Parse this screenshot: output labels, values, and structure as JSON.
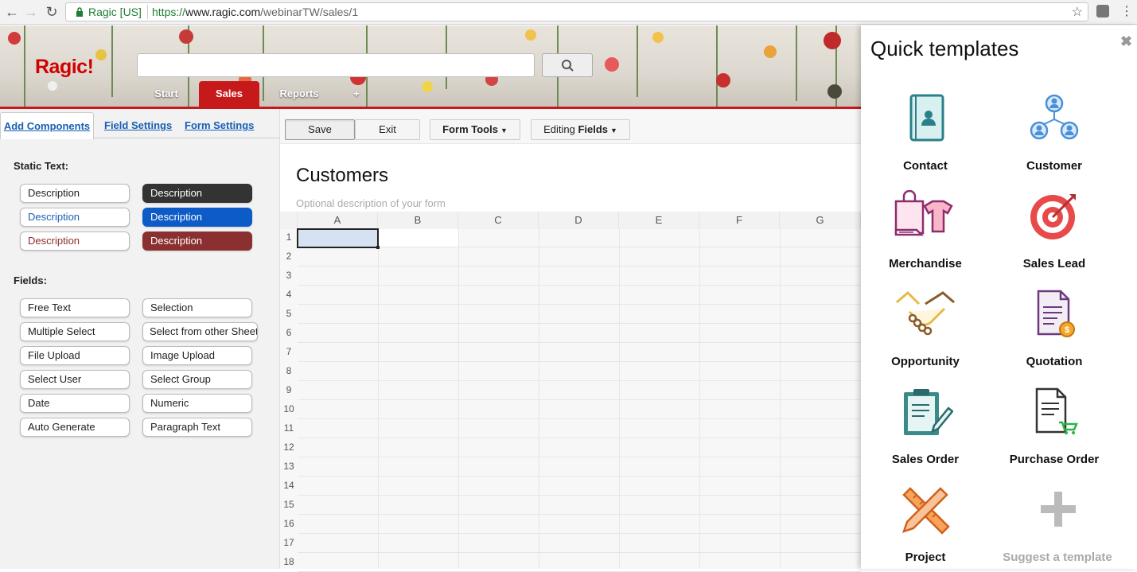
{
  "browser": {
    "site_name": "Ragic [US]",
    "url_proto": "https://",
    "url_host": "www.ragic.com",
    "url_path": "/webinarTW/sales/1"
  },
  "header": {
    "logo": "Ragic!",
    "search_placeholder": "",
    "tabs": [
      {
        "label": "Start",
        "active": false
      },
      {
        "label": "Sales",
        "active": true
      },
      {
        "label": "Reports",
        "active": false
      },
      {
        "label": "+",
        "active": false
      }
    ]
  },
  "left_panel": {
    "tabs": [
      "Add Components",
      "Field Settings",
      "Form Settings"
    ],
    "static_text_title": "Static Text:",
    "static_text": [
      {
        "label": "Description",
        "bg": "#ffffff",
        "fg": "#222222"
      },
      {
        "label": "Description",
        "bg": "#333333",
        "fg": "#ffffff"
      },
      {
        "label": "Description",
        "bg": "#ffffff",
        "fg": "#1a5fb4"
      },
      {
        "label": "Description",
        "bg": "#0d5bc6",
        "fg": "#ffffff"
      },
      {
        "label": "Description",
        "bg": "#ffffff",
        "fg": "#8b2d2d"
      },
      {
        "label": "Description",
        "bg": "#8b3030",
        "fg": "#ffffff"
      }
    ],
    "fields_title": "Fields:",
    "fields": [
      "Free Text",
      "Selection",
      "Multiple Select",
      "Select from other Sheet",
      "File Upload",
      "Image Upload",
      "Select User",
      "Select Group",
      "Date",
      "Numeric",
      "Auto Generate",
      "Paragraph Text"
    ]
  },
  "toolbar": {
    "save": "Save",
    "exit": "Exit",
    "form_tools": "Form Tools",
    "editing_prefix": "Editing",
    "editing_bold": "Fields"
  },
  "form": {
    "title": "Customers",
    "description": "Optional description of your form",
    "columns": [
      "A",
      "B",
      "C",
      "D",
      "E",
      "F",
      "G"
    ],
    "rows": [
      "1",
      "2",
      "3",
      "4",
      "5",
      "6",
      "7",
      "8",
      "9",
      "10",
      "11",
      "12",
      "13",
      "14",
      "15",
      "16",
      "17",
      "18"
    ]
  },
  "quick_templates": {
    "title": "Quick templates",
    "close": "✖",
    "items": [
      {
        "label": "Contact",
        "icon": "contact-book-icon"
      },
      {
        "label": "Customer",
        "icon": "customer-group-icon"
      },
      {
        "label": "Merchandise",
        "icon": "shopping-bag-icon"
      },
      {
        "label": "Sales Lead",
        "icon": "target-icon"
      },
      {
        "label": "Opportunity",
        "icon": "handshake-icon"
      },
      {
        "label": "Quotation",
        "icon": "quotation-doc-icon"
      },
      {
        "label": "Sales Order",
        "icon": "clipboard-icon"
      },
      {
        "label": "Purchase Order",
        "icon": "purchase-doc-icon"
      },
      {
        "label": "Project",
        "icon": "ruler-pencil-icon"
      },
      {
        "label": "Suggest a template",
        "icon": "plus-icon"
      }
    ]
  },
  "colors": {
    "brand_red": "#c8191a",
    "link_blue": "#1a5fb4"
  }
}
